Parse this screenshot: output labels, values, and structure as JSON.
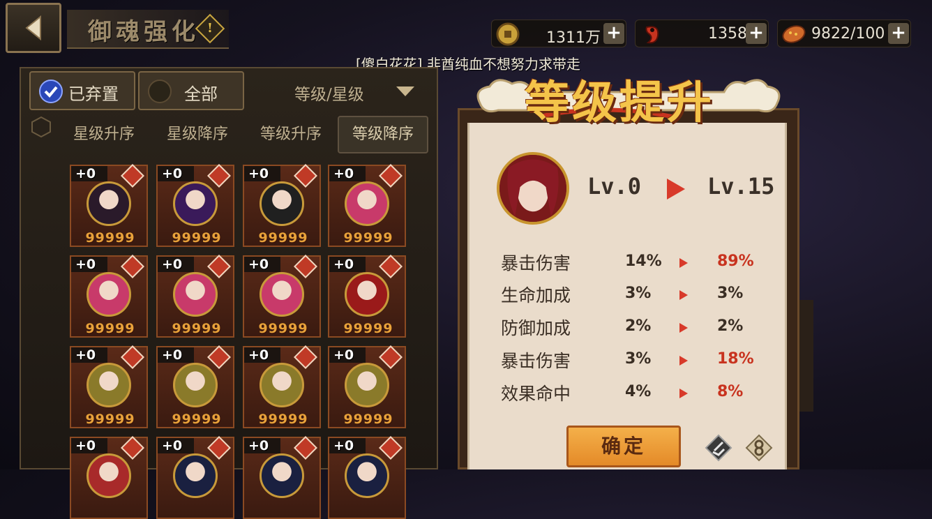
{
  "header": {
    "title": "御魂强化",
    "hint_icon": "exclamation-diamond",
    "back_icon": "back-arrow"
  },
  "resources": [
    {
      "name": "coin",
      "value": "1311万"
    },
    {
      "name": "jade",
      "value": "1358"
    },
    {
      "name": "stamina",
      "value": "9822/100"
    }
  ],
  "marquee": "[傻白花花] 非酋纯血不想努力求带走",
  "filters": {
    "discarded_label": "已弃置",
    "all_label": "全部",
    "sort_dropdown": "等级/星级"
  },
  "sort_tabs": [
    {
      "label": "星级升序",
      "active": false
    },
    {
      "label": "星级降序",
      "active": false
    },
    {
      "label": "等级升序",
      "active": false
    },
    {
      "label": "等级降序",
      "active": true
    }
  ],
  "cards": [
    {
      "plus": "+0",
      "num": "99999",
      "portrait": "masked-black",
      "color": "#2a1a2a"
    },
    {
      "plus": "+0",
      "num": "99999",
      "portrait": "purple-flame",
      "color": "#3a1a5a"
    },
    {
      "plus": "+0",
      "num": "99999",
      "portrait": "black-cat",
      "color": "#202020"
    },
    {
      "plus": "+0",
      "num": "99999",
      "portrait": "pink-hair",
      "color": "#c83a6a"
    },
    {
      "plus": "+0",
      "num": "99999",
      "portrait": "pink-hair",
      "color": "#c83a6a"
    },
    {
      "plus": "+0",
      "num": "99999",
      "portrait": "pink-hair",
      "color": "#c83a6a"
    },
    {
      "plus": "+0",
      "num": "99999",
      "portrait": "pink-hair",
      "color": "#c83a6a"
    },
    {
      "plus": "+0",
      "num": "99999",
      "portrait": "red-oni",
      "color": "#9a1a1a"
    },
    {
      "plus": "+0",
      "num": "99999",
      "portrait": "gold-mask",
      "color": "#8a7a2a"
    },
    {
      "plus": "+0",
      "num": "99999",
      "portrait": "gold-mask",
      "color": "#8a7a2a"
    },
    {
      "plus": "+0",
      "num": "99999",
      "portrait": "gold-mask",
      "color": "#8a7a2a"
    },
    {
      "plus": "+0",
      "num": "99999",
      "portrait": "gold-mask",
      "color": "#8a7a2a"
    },
    {
      "plus": "+0",
      "num": "",
      "portrait": "red-hair",
      "color": "#a82a2a"
    },
    {
      "plus": "+0",
      "num": "",
      "portrait": "dark-blue",
      "color": "#1a2040"
    },
    {
      "plus": "+0",
      "num": "",
      "portrait": "dark-blue",
      "color": "#1a2040"
    },
    {
      "plus": "+0",
      "num": "",
      "portrait": "dark-blue",
      "color": "#1a2040"
    }
  ],
  "popup": {
    "banner": "等级提升",
    "level_from": "Lv.0",
    "level_to": "Lv.15",
    "stats": [
      {
        "name": "暴击伤害",
        "from": "14%",
        "to": "89%",
        "up": true
      },
      {
        "name": "生命加成",
        "from": "3%",
        "to": "3%",
        "up": false
      },
      {
        "name": "防御加成",
        "from": "2%",
        "to": "2%",
        "up": false
      },
      {
        "name": "暴击伤害",
        "from": "3%",
        "to": "18%",
        "up": true
      },
      {
        "name": "效果命中",
        "from": "4%",
        "to": "8%",
        "up": true
      }
    ],
    "confirm_label": "确定"
  },
  "colors": {
    "stat_up": "#c8331f",
    "stat_same": "#3a2e24",
    "accent_gold": "#f4c44a"
  }
}
